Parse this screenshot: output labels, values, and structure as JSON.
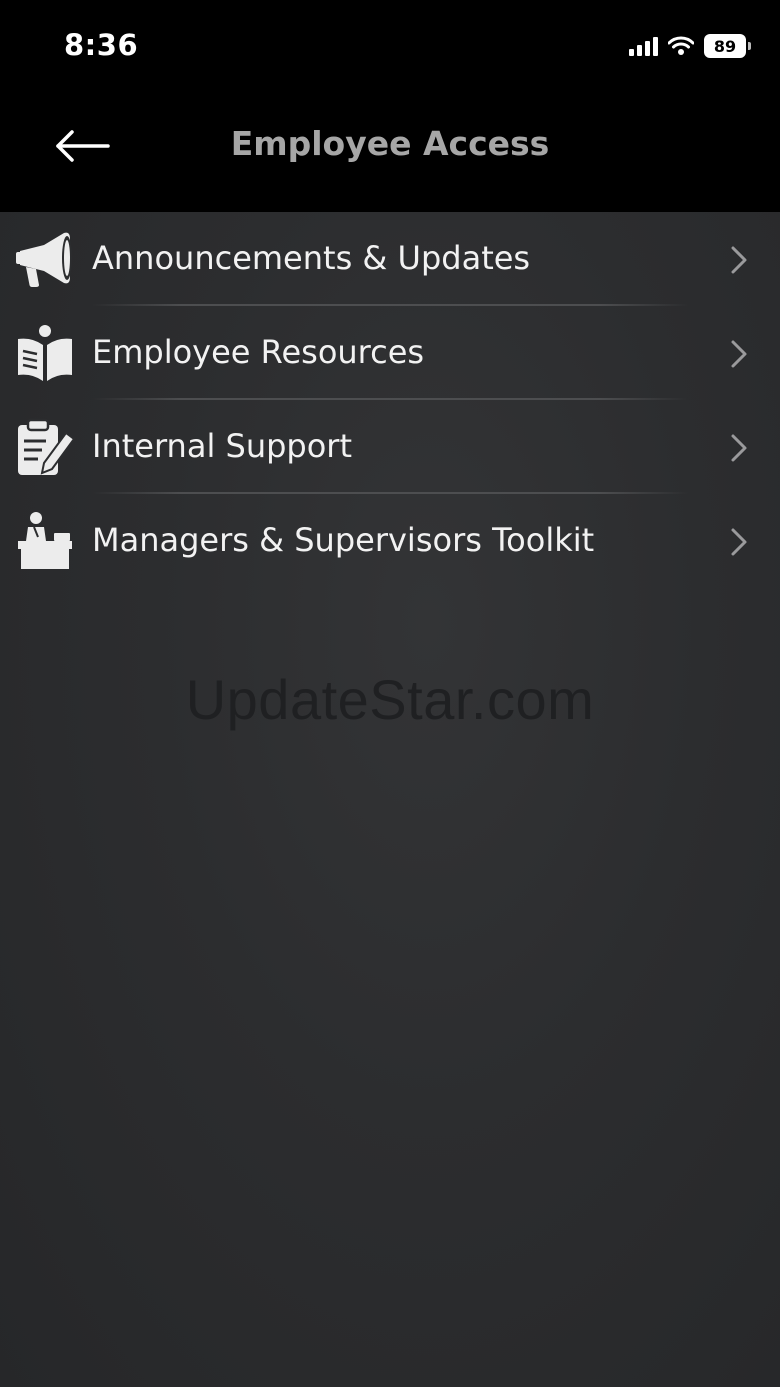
{
  "status_bar": {
    "time": "8:36",
    "battery": "89",
    "icons": [
      "cellular-signal-icon",
      "wifi-icon",
      "battery-icon"
    ]
  },
  "nav": {
    "title": "Employee Access",
    "back_icon": "arrow-left-icon"
  },
  "menu": {
    "items": [
      {
        "label": "Announcements & Updates",
        "icon": "megaphone-icon"
      },
      {
        "label": "Employee Resources",
        "icon": "reading-book-icon"
      },
      {
        "label": "Internal Support",
        "icon": "clipboard-pencil-icon"
      },
      {
        "label": "Managers & Supervisors Toolkit",
        "icon": "person-at-desk-icon"
      }
    ],
    "chevron_icon": "chevron-right-icon"
  },
  "watermark": "UpdateStar.com",
  "colors": {
    "header_bg": "#000000",
    "content_bg": "#2c2d2f",
    "title_text": "#a6a6a6",
    "item_text": "#f2f2f2",
    "icon": "#ececec"
  }
}
